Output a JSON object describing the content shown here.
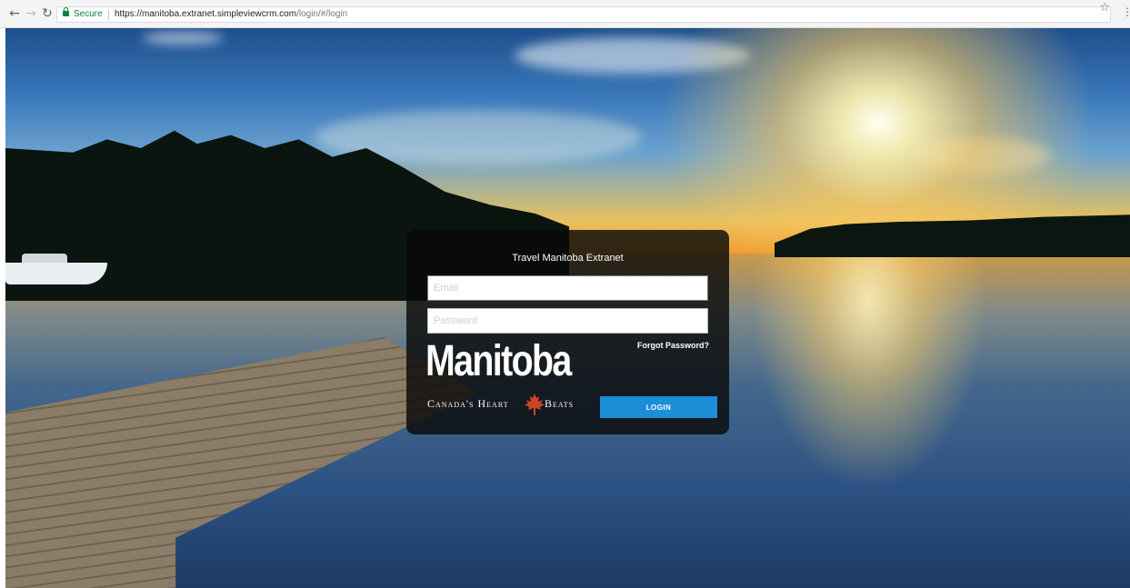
{
  "browser": {
    "back_icon": "arrow-left-icon",
    "forward_icon": "arrow-right-icon",
    "reload_icon": "reload-icon",
    "secure_label": "Secure",
    "url_host": "https://manitoba.extranet.simpleviewcrm.com",
    "url_path": "/login/#/login",
    "bookmark_icon": "star-icon",
    "menu_icon": "kebab-menu-icon"
  },
  "login": {
    "title": "Travel Manitoba Extranet",
    "email_placeholder": "Email",
    "email_value": "",
    "password_placeholder": "Password",
    "password_value": "",
    "forgot_label": "Forgot Password?",
    "button_label": "LOGIN"
  },
  "logo": {
    "word": "Manitoba",
    "tagline_left": "Canada's Heart",
    "tagline_right": "Beats",
    "icon": "maple-leaf-icon",
    "icon_color": "#c8452a"
  },
  "colors": {
    "accent": "#1a8ed6",
    "secure": "#0b8043"
  }
}
